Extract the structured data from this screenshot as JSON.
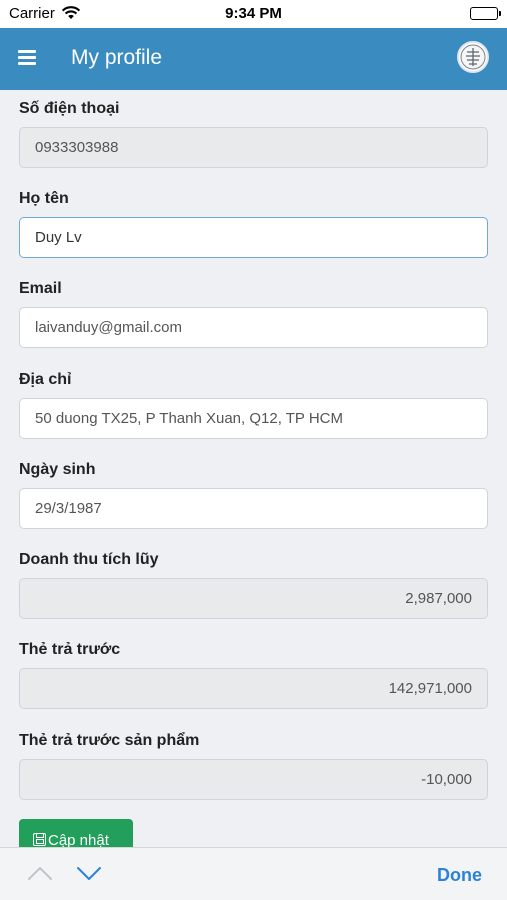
{
  "status_bar": {
    "carrier": "Carrier",
    "time": "9:34 PM"
  },
  "header": {
    "title": "My profile",
    "menu_icon": "hamburger-icon",
    "avatar_icon": "profile-avatar"
  },
  "fields": {
    "phone": {
      "label": "Số điện thoại",
      "value": "0933303988"
    },
    "name": {
      "label": "Họ tên",
      "value": "Duy Lv"
    },
    "email": {
      "label": "Email",
      "value": "laivanduy@gmail.com"
    },
    "address": {
      "label": "Địa chỉ",
      "value": "50 duong TX25, P Thanh Xuan, Q12, TP HCM"
    },
    "birthday": {
      "label": "Ngày sinh",
      "value": "29/3/1987"
    },
    "revenue": {
      "label": "Doanh thu tích lũy",
      "value": "2,987,000"
    },
    "prepaid": {
      "label": "Thẻ trả trước",
      "value": "142,971,000"
    },
    "prepaid_product": {
      "label": "Thẻ trả trước sản phẩm",
      "value": "-10,000"
    }
  },
  "save_button": {
    "label": "Cập nhật",
    "icon": "save-icon"
  },
  "keyboard_toolbar": {
    "done_label": "Done",
    "prev_icon": "chevron-up-icon",
    "next_icon": "chevron-down-icon"
  },
  "colors": {
    "header": "#3a8bbf",
    "save_button": "#22a05b",
    "done": "#2d82d5"
  }
}
